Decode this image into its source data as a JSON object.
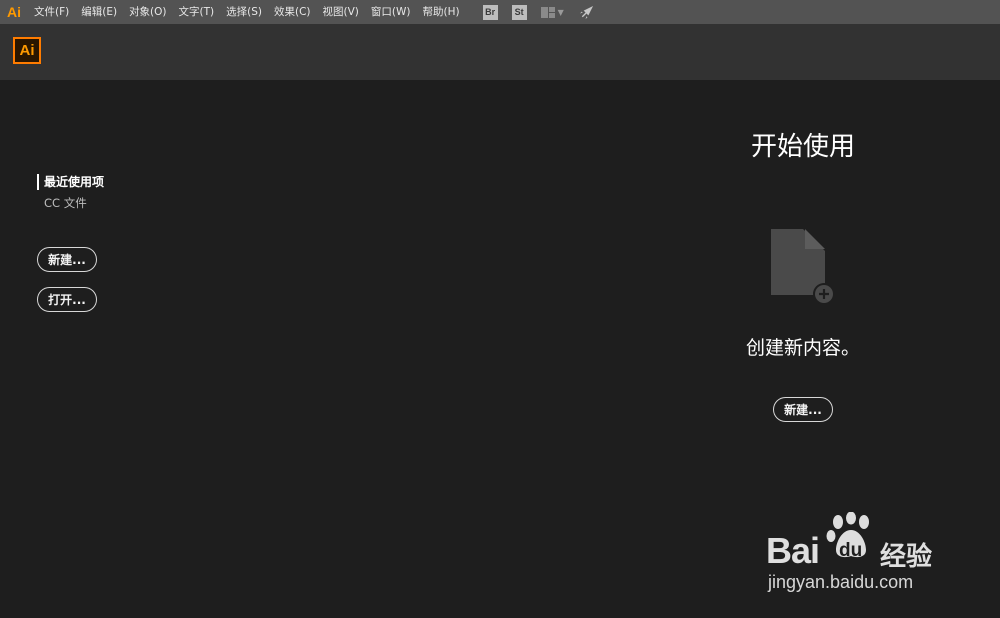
{
  "app": {
    "glyph": "Ai",
    "logo_text": "Ai",
    "accent_color": "#ff7c00"
  },
  "menubar": {
    "items": [
      "文件(F)",
      "编辑(E)",
      "对象(O)",
      "文字(T)",
      "选择(S)",
      "效果(C)",
      "视图(V)",
      "窗口(W)",
      "帮助(H)"
    ],
    "bridge_badge": "Br",
    "stock_badge": "St",
    "icons": [
      "workspace-switcher-icon",
      "rocket-icon"
    ]
  },
  "sidebar": {
    "tabs": [
      {
        "label": "最近使用项",
        "active": true
      },
      {
        "label": "CC 文件",
        "active": false
      }
    ],
    "new_button": "新建...",
    "open_button": "打开..."
  },
  "start": {
    "title": "开始使用",
    "create_text": "创建新内容。",
    "new_button": "新建...",
    "icon": "new-document-icon"
  },
  "watermark": {
    "brand": "Bai",
    "brand_suffix": "du",
    "cn": "经验",
    "url": "jingyan.baidu.com"
  }
}
